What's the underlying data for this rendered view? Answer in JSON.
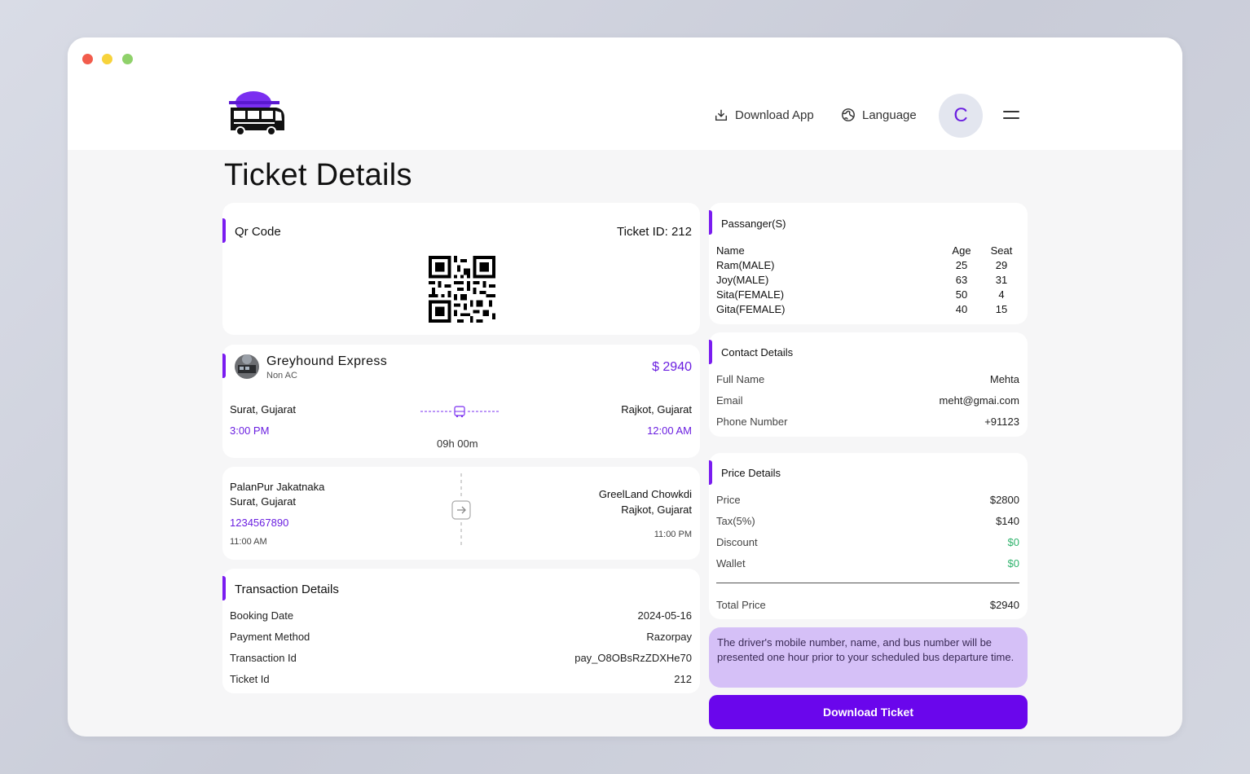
{
  "header": {
    "download_app": "Download App",
    "language": "Language",
    "avatar_letter": "C"
  },
  "page_title": "Ticket Details",
  "qr_card": {
    "title": "Qr Code",
    "ticket_id": "Ticket ID: 212"
  },
  "bus_card": {
    "name": "Greyhound Express",
    "type": "Non AC",
    "price": "$ 2940",
    "from_city": "Surat, Gujarat",
    "from_time": "3:00 PM",
    "to_city": "Rajkot, Gujarat",
    "to_time": "12:00 AM",
    "duration": "09h 00m"
  },
  "stops_card": {
    "pickup_point": "PalanPur Jakatnaka",
    "pickup_city": "Surat, Gujarat",
    "pickup_phone": "1234567890",
    "pickup_time": "11:00 AM",
    "drop_point": "GreelLand Chowkdi",
    "drop_city": "Rajkot, Gujarat",
    "drop_time": "11:00 PM"
  },
  "transaction": {
    "title": "Transaction Details",
    "rows": [
      {
        "label": "Booking Date",
        "value": "2024-05-16"
      },
      {
        "label": "Payment Method",
        "value": "Razorpay"
      },
      {
        "label": "Transaction Id",
        "value": "pay_O8OBsRzZDXHe70"
      },
      {
        "label": "Ticket Id",
        "value": "212"
      }
    ]
  },
  "passengers": {
    "title": "Passanger(S)",
    "headers": {
      "name": "Name",
      "age": "Age",
      "seat": "Seat"
    },
    "rows": [
      {
        "name": "Ram(MALE)",
        "age": "25",
        "seat": "29"
      },
      {
        "name": "Joy(MALE)",
        "age": "63",
        "seat": "31"
      },
      {
        "name": "Sita(FEMALE)",
        "age": "50",
        "seat": "4"
      },
      {
        "name": "Gita(FEMALE)",
        "age": "40",
        "seat": "15"
      }
    ]
  },
  "contact": {
    "title": "Contact Details",
    "rows": [
      {
        "label": "Full Name",
        "value": "Mehta"
      },
      {
        "label": "Email",
        "value": "meht@gmai.com"
      },
      {
        "label": "Phone Number",
        "value": "+91123"
      }
    ]
  },
  "price": {
    "title": "Price Details",
    "rows": [
      {
        "label": "Price",
        "value": "$2800"
      },
      {
        "label": "Tax(5%)",
        "value": "$140"
      },
      {
        "label": "Discount",
        "value": "$0"
      },
      {
        "label": "Wallet",
        "value": "$0"
      }
    ],
    "total_label": "Total Price",
    "total_value": "$2940"
  },
  "note": "The driver's mobile number, name, and bus number will be presented one hour prior to your scheduled bus departure time.",
  "download_ticket": "Download Ticket",
  "colors": {
    "accent": "#6a06ec",
    "green": "#2fb36c",
    "note_bg": "#d5c0f7"
  }
}
